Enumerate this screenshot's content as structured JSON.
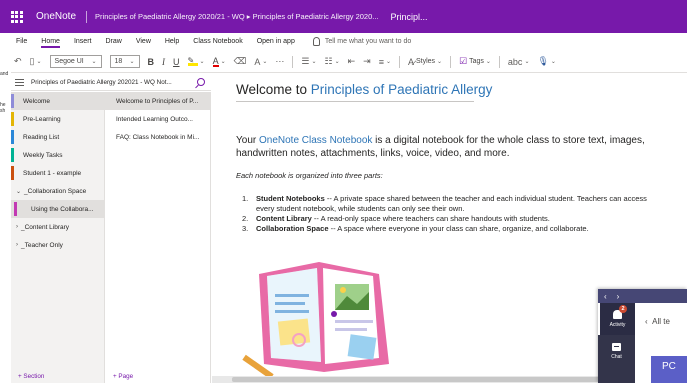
{
  "titlebar": {
    "app_name": "OneNote",
    "breadcrumb": "Principles of Paediatric Allergy 2020/21 - WQ ▸ Principles of Paediatric Allergy 2020...",
    "page": "Principl..."
  },
  "menu": {
    "items": [
      "File",
      "Home",
      "Insert",
      "Draw",
      "View",
      "Help",
      "Class Notebook",
      "Open in app"
    ],
    "active": "Home",
    "search_placeholder": "Tell me what you want to do"
  },
  "ribbon": {
    "font": "Segoe UI",
    "size": "18",
    "bold": "B",
    "italic": "I",
    "underline": "U",
    "styles_label": "Styles",
    "tags_label": "Tags"
  },
  "edge_clip": [
    "and",
    "he sh"
  ],
  "notebook": {
    "title": "Principles of Paediatric Allergy 202021 - WQ Not..."
  },
  "sections": [
    {
      "label": "Welcome",
      "color": "#8e8cd8",
      "selected": true
    },
    {
      "label": "Pre-Learning",
      "color": "#e3b505"
    },
    {
      "label": "Reading List",
      "color": "#2b88d8"
    },
    {
      "label": "Weekly Tasks",
      "color": "#00b294"
    },
    {
      "label": "Student 1 - example",
      "color": "#ca5010"
    }
  ],
  "section_groups": {
    "collab": "_Collaboration Space",
    "collab_sub": "Using the Collabora...",
    "collab_sub_color": "#c239b3",
    "library": "_Content Library",
    "teacher": "_Teacher Only"
  },
  "section_footer": "+ Section",
  "pages": [
    {
      "label": "Welcome to Principles of P...",
      "selected": true
    },
    {
      "label": "Intended Learning Outco..."
    },
    {
      "label": "FAQ: Class Notebook in Mi..."
    }
  ],
  "page_footer": "+ Page",
  "content": {
    "title_prefix": "Welcome to ",
    "title_accent": "Principles of Paediatric Allergy",
    "intro_prefix": "Your ",
    "intro_accent": "OneNote Class Notebook",
    "intro_rest": " is a digital notebook for the whole class to store text, images, handwritten notes, attachments, links, voice, video, and more.",
    "organized": "Each notebook is organized into three parts:",
    "parts": [
      {
        "num": "1.",
        "name": "Student Notebooks",
        "desc": " -- A private space shared between the teacher and each individual student. Teachers can access every student notebook, while students can only see their own."
      },
      {
        "num": "2.",
        "name": "Content Library",
        "desc": " -- A read-only space where teachers can share handouts with students."
      },
      {
        "num": "3.",
        "name": "Collaboration Space",
        "desc": " -- A space where everyone in your class can share, organize, and collaborate."
      }
    ],
    "accent_color": "#2e75b6"
  },
  "teams": {
    "activity_label": "Activity",
    "activity_count": "2",
    "chat_label": "Chat",
    "back_label": "All te",
    "pc_label": "PC"
  }
}
